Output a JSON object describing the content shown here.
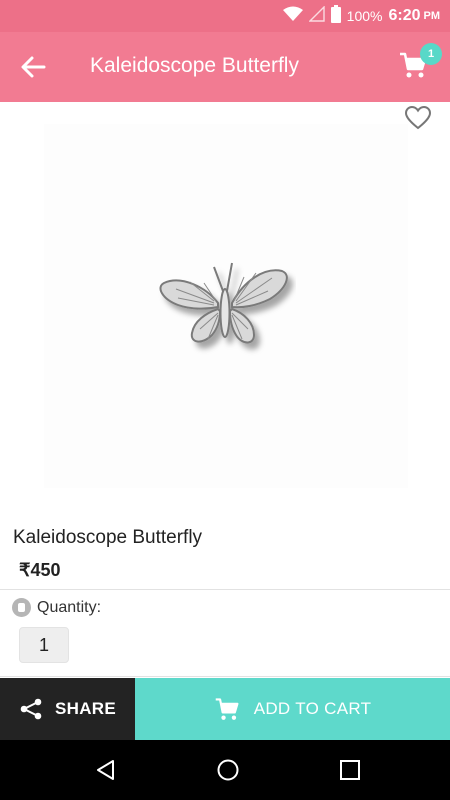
{
  "status_bar": {
    "battery": "100%",
    "time": "6:20",
    "ampm": "PM",
    "icons": [
      "wifi-icon",
      "signal-icon",
      "battery-icon"
    ]
  },
  "toolbar": {
    "title": "Kaleidoscope Butterfly",
    "cart_count": "1",
    "icons": [
      "back-arrow-icon",
      "cart-icon"
    ]
  },
  "product": {
    "name": "Kaleidoscope Butterfly",
    "price": "₹450",
    "image": "butterfly-die-image"
  },
  "quantity": {
    "label": "Quantity:",
    "value": "1"
  },
  "actions": {
    "share_label": "SHARE",
    "add_to_cart_label": "ADD TO CART"
  },
  "colors": {
    "toolbar": "#f27b92",
    "status_bar": "#ed7088",
    "badge": "#58d8c8",
    "add_to_cart": "#5ed9cb",
    "share": "#232323"
  }
}
